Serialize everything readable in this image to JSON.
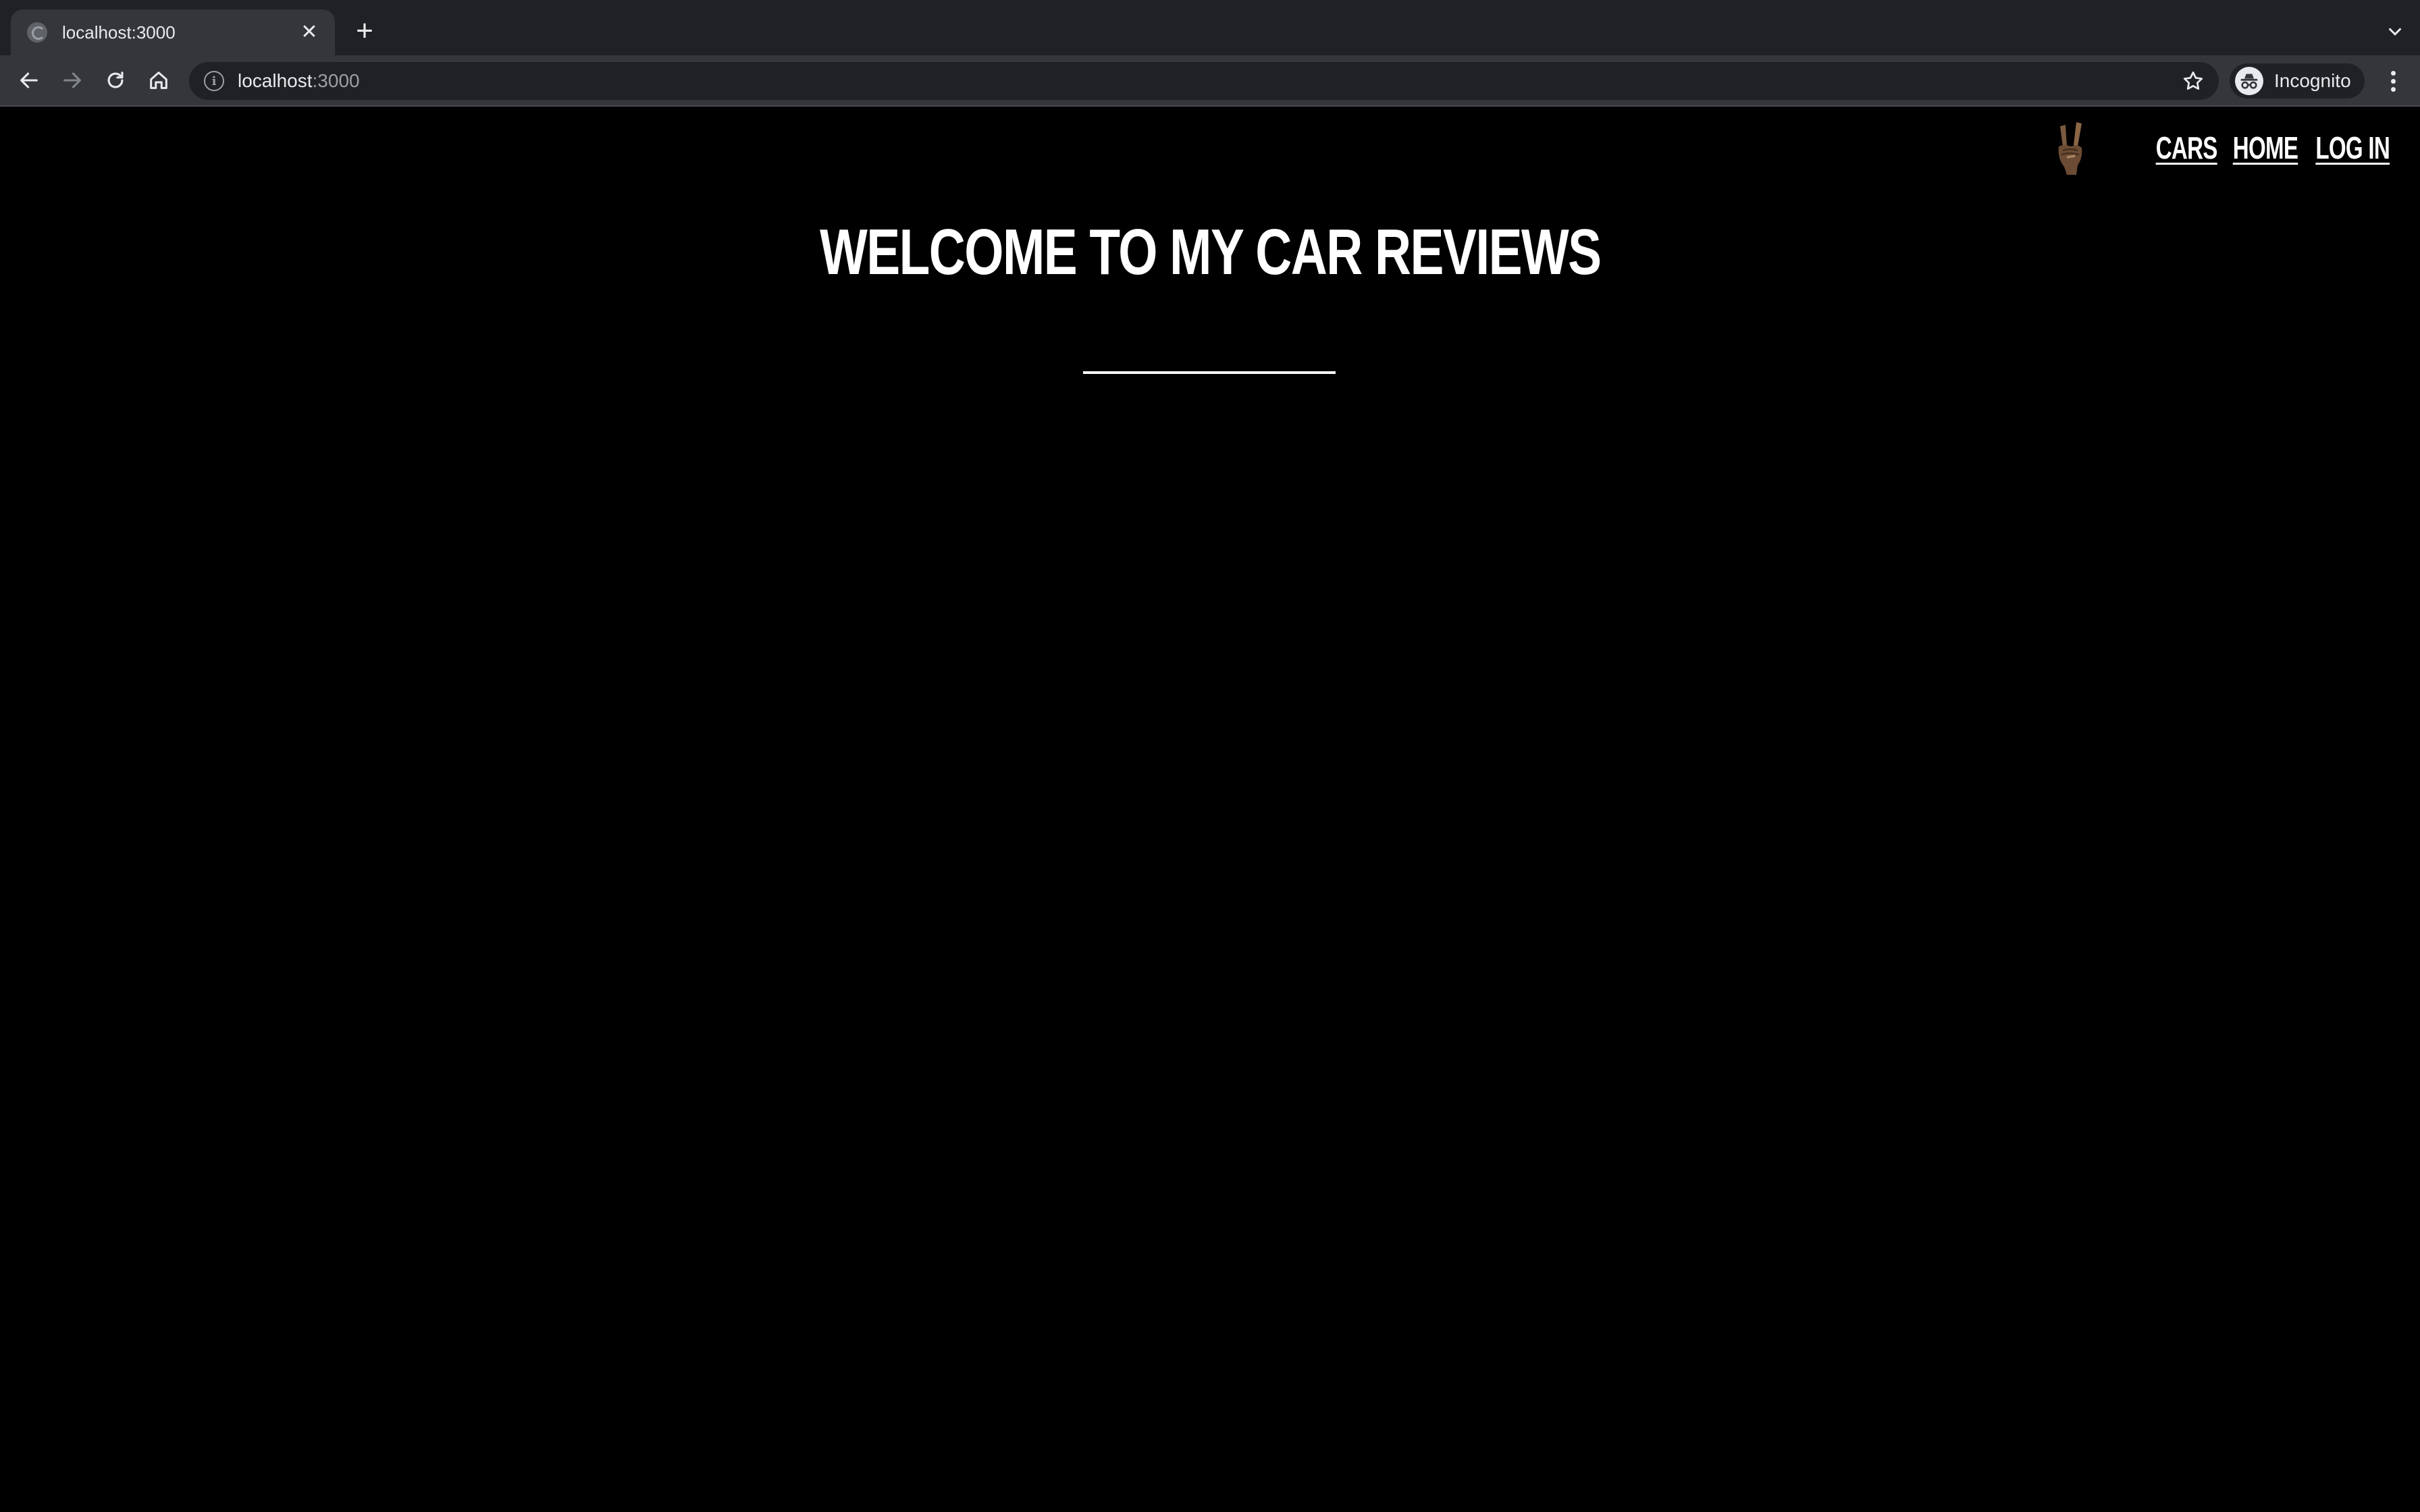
{
  "browser": {
    "tab": {
      "title": "localhost:3000",
      "close": "✕",
      "favicon": "globe-icon"
    },
    "new_tab": "+",
    "address": {
      "host": "localhost",
      "port": ":3000"
    },
    "profile_label": "Incognito",
    "icons": {
      "back": "arrow-left-icon",
      "forward": "arrow-right-icon",
      "reload": "reload-icon",
      "home": "home-icon",
      "info": "info-icon",
      "bookmark": "star-icon",
      "incognito": "incognito-icon",
      "menu": "kebab-menu-icon",
      "tab_list": "chevron-down-icon"
    }
  },
  "site": {
    "logo": "rock-hand-icon",
    "nav": [
      {
        "label": "CARS"
      },
      {
        "label": "HOME"
      },
      {
        "label": "LOG IN"
      }
    ],
    "hero_title": "WELCOME TO MY CAR REVIEWS"
  },
  "colors": {
    "chrome_dark": "#202124",
    "chrome_light": "#35363a",
    "page_bg": "#000000",
    "page_text": "#ffffff"
  }
}
